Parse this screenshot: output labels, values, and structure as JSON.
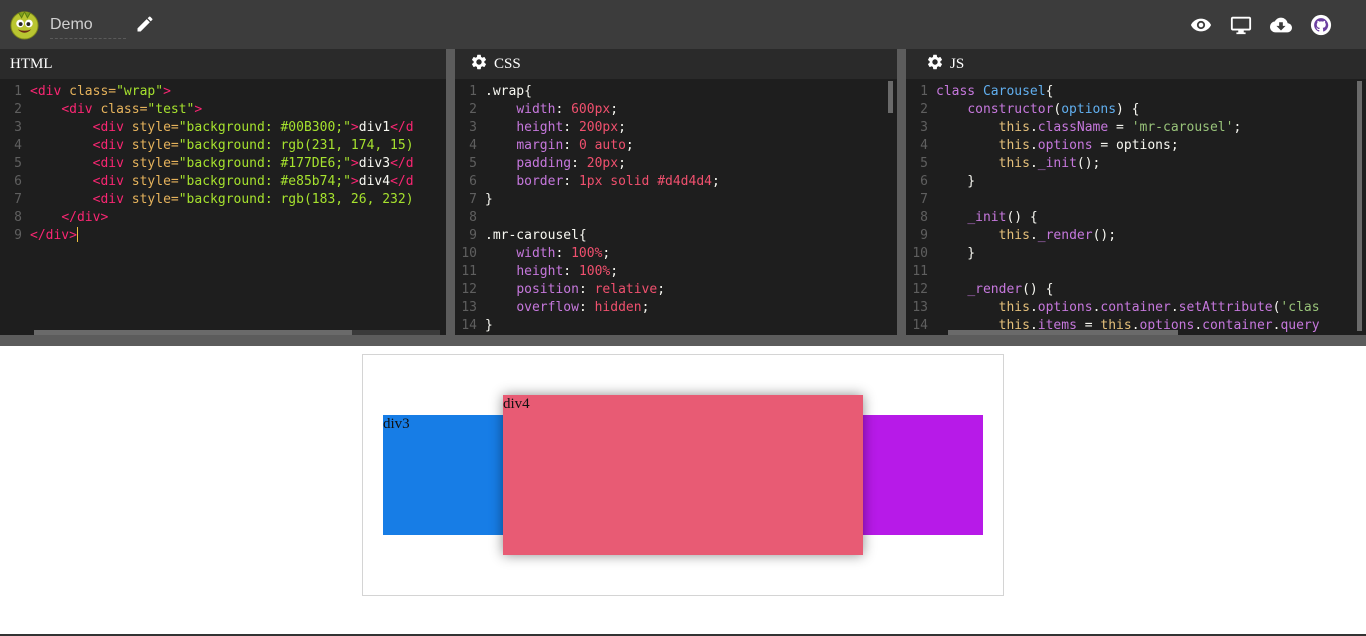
{
  "app": {
    "title": "Demo"
  },
  "icons": {
    "logo": "avatar-logo",
    "edit": "pencil-icon",
    "preview": "eye-icon",
    "display": "monitor-icon",
    "download": "cloud-download-icon",
    "github": "github-icon",
    "settings": "gear-icon"
  },
  "panels": {
    "html": {
      "label": "HTML"
    },
    "css": {
      "label": "CSS"
    },
    "js": {
      "label": "JS"
    }
  },
  "html_lines": [
    {
      "n": "1",
      "parts": [
        [
          "c-tag",
          "<div "
        ],
        [
          "c-attr",
          "class="
        ],
        [
          "c-str",
          "\"wrap\""
        ],
        [
          "c-tag",
          ">"
        ]
      ]
    },
    {
      "n": "2",
      "parts": [
        [
          "c-plain",
          "    "
        ],
        [
          "c-tag",
          "<div "
        ],
        [
          "c-attr",
          "class="
        ],
        [
          "c-str",
          "\"test\""
        ],
        [
          "c-tag",
          ">"
        ]
      ]
    },
    {
      "n": "3",
      "parts": [
        [
          "c-plain",
          "        "
        ],
        [
          "c-tag",
          "<div "
        ],
        [
          "c-attr",
          "style="
        ],
        [
          "c-str",
          "\"background: #00B300;\""
        ],
        [
          "c-tag",
          ">"
        ],
        [
          "c-plain",
          "div1"
        ],
        [
          "c-tag",
          "</d"
        ]
      ]
    },
    {
      "n": "4",
      "parts": [
        [
          "c-plain",
          "        "
        ],
        [
          "c-tag",
          "<div "
        ],
        [
          "c-attr",
          "style="
        ],
        [
          "c-str",
          "\"background: rgb(231, 174, 15)"
        ]
      ]
    },
    {
      "n": "5",
      "parts": [
        [
          "c-plain",
          "        "
        ],
        [
          "c-tag",
          "<div "
        ],
        [
          "c-attr",
          "style="
        ],
        [
          "c-str",
          "\"background: #177DE6;\""
        ],
        [
          "c-tag",
          ">"
        ],
        [
          "c-plain",
          "div3"
        ],
        [
          "c-tag",
          "</d"
        ]
      ]
    },
    {
      "n": "6",
      "parts": [
        [
          "c-plain",
          "        "
        ],
        [
          "c-tag",
          "<div "
        ],
        [
          "c-attr",
          "style="
        ],
        [
          "c-str",
          "\"background: #e85b74;\""
        ],
        [
          "c-tag",
          ">"
        ],
        [
          "c-plain",
          "div4"
        ],
        [
          "c-tag",
          "</d"
        ]
      ]
    },
    {
      "n": "7",
      "parts": [
        [
          "c-plain",
          "        "
        ],
        [
          "c-tag",
          "<div "
        ],
        [
          "c-attr",
          "style="
        ],
        [
          "c-str",
          "\"background: rgb(183, 26, 232)"
        ]
      ]
    },
    {
      "n": "8",
      "parts": [
        [
          "c-plain",
          "    "
        ],
        [
          "c-tag",
          "</div>"
        ]
      ]
    },
    {
      "n": "9",
      "parts": [
        [
          "c-tag",
          "</div>"
        ]
      ]
    }
  ],
  "css_lines": [
    {
      "n": "1",
      "parts": [
        [
          "c-sel",
          ".wrap{"
        ]
      ]
    },
    {
      "n": "2",
      "parts": [
        [
          "c-plain",
          "    "
        ],
        [
          "c-prop",
          "width"
        ],
        [
          "c-plain",
          ": "
        ],
        [
          "c-val",
          "600px"
        ],
        [
          "c-plain",
          ";"
        ]
      ]
    },
    {
      "n": "3",
      "parts": [
        [
          "c-plain",
          "    "
        ],
        [
          "c-prop",
          "height"
        ],
        [
          "c-plain",
          ": "
        ],
        [
          "c-val",
          "200px"
        ],
        [
          "c-plain",
          ";"
        ]
      ]
    },
    {
      "n": "4",
      "parts": [
        [
          "c-plain",
          "    "
        ],
        [
          "c-prop",
          "margin"
        ],
        [
          "c-plain",
          ": "
        ],
        [
          "c-val",
          "0 auto"
        ],
        [
          "c-plain",
          ";"
        ]
      ]
    },
    {
      "n": "5",
      "parts": [
        [
          "c-plain",
          "    "
        ],
        [
          "c-prop",
          "padding"
        ],
        [
          "c-plain",
          ": "
        ],
        [
          "c-val",
          "20px"
        ],
        [
          "c-plain",
          ";"
        ]
      ]
    },
    {
      "n": "6",
      "parts": [
        [
          "c-plain",
          "    "
        ],
        [
          "c-prop",
          "border"
        ],
        [
          "c-plain",
          ": "
        ],
        [
          "c-val",
          "1px solid #d4d4d4"
        ],
        [
          "c-plain",
          ";"
        ]
      ]
    },
    {
      "n": "7",
      "parts": [
        [
          "c-sel",
          "}"
        ]
      ]
    },
    {
      "n": "8",
      "parts": []
    },
    {
      "n": "9",
      "parts": [
        [
          "c-sel",
          ".mr-carousel{"
        ]
      ]
    },
    {
      "n": "10",
      "parts": [
        [
          "c-plain",
          "    "
        ],
        [
          "c-prop",
          "width"
        ],
        [
          "c-plain",
          ": "
        ],
        [
          "c-val",
          "100%"
        ],
        [
          "c-plain",
          ";"
        ]
      ]
    },
    {
      "n": "11",
      "parts": [
        [
          "c-plain",
          "    "
        ],
        [
          "c-prop",
          "height"
        ],
        [
          "c-plain",
          ": "
        ],
        [
          "c-val",
          "100%"
        ],
        [
          "c-plain",
          ";"
        ]
      ]
    },
    {
      "n": "12",
      "parts": [
        [
          "c-plain",
          "    "
        ],
        [
          "c-prop",
          "position"
        ],
        [
          "c-plain",
          ": "
        ],
        [
          "c-val",
          "relative"
        ],
        [
          "c-plain",
          ";"
        ]
      ]
    },
    {
      "n": "13",
      "parts": [
        [
          "c-plain",
          "    "
        ],
        [
          "c-prop",
          "overflow"
        ],
        [
          "c-plain",
          ": "
        ],
        [
          "c-val",
          "hidden"
        ],
        [
          "c-plain",
          ";"
        ]
      ]
    },
    {
      "n": "14",
      "parts": [
        [
          "c-sel",
          "}"
        ]
      ]
    }
  ],
  "js_lines": [
    {
      "n": "1",
      "parts": [
        [
          "c-kw",
          "class "
        ],
        [
          "c-cls",
          "Carousel"
        ],
        [
          "c-plain",
          "{"
        ]
      ]
    },
    {
      "n": "2",
      "parts": [
        [
          "c-plain",
          "    "
        ],
        [
          "c-kw",
          "constructor"
        ],
        [
          "c-plain",
          "("
        ],
        [
          "c-cls",
          "options"
        ],
        [
          "c-plain",
          ") {"
        ]
      ]
    },
    {
      "n": "3",
      "parts": [
        [
          "c-plain",
          "        "
        ],
        [
          "c-this",
          "this"
        ],
        [
          "c-plain",
          "."
        ],
        [
          "c-prop",
          "className"
        ],
        [
          "c-plain",
          " = "
        ],
        [
          "c-jstr",
          "'mr-carousel'"
        ],
        [
          "c-plain",
          ";"
        ]
      ]
    },
    {
      "n": "4",
      "parts": [
        [
          "c-plain",
          "        "
        ],
        [
          "c-this",
          "this"
        ],
        [
          "c-plain",
          "."
        ],
        [
          "c-prop",
          "options"
        ],
        [
          "c-plain",
          " = options;"
        ]
      ]
    },
    {
      "n": "5",
      "parts": [
        [
          "c-plain",
          "        "
        ],
        [
          "c-this",
          "this"
        ],
        [
          "c-plain",
          "."
        ],
        [
          "c-prop",
          "_init"
        ],
        [
          "c-plain",
          "();"
        ]
      ]
    },
    {
      "n": "6",
      "parts": [
        [
          "c-plain",
          "    }"
        ]
      ]
    },
    {
      "n": "7",
      "parts": []
    },
    {
      "n": "8",
      "parts": [
        [
          "c-plain",
          "    "
        ],
        [
          "c-prop",
          "_init"
        ],
        [
          "c-plain",
          "() {"
        ]
      ]
    },
    {
      "n": "9",
      "parts": [
        [
          "c-plain",
          "        "
        ],
        [
          "c-this",
          "this"
        ],
        [
          "c-plain",
          "."
        ],
        [
          "c-prop",
          "_render"
        ],
        [
          "c-plain",
          "();"
        ]
      ]
    },
    {
      "n": "10",
      "parts": [
        [
          "c-plain",
          "    }"
        ]
      ]
    },
    {
      "n": "11",
      "parts": []
    },
    {
      "n": "12",
      "parts": [
        [
          "c-plain",
          "    "
        ],
        [
          "c-prop",
          "_render"
        ],
        [
          "c-plain",
          "() {"
        ]
      ]
    },
    {
      "n": "13",
      "parts": [
        [
          "c-plain",
          "        "
        ],
        [
          "c-this",
          "this"
        ],
        [
          "c-plain",
          "."
        ],
        [
          "c-prop",
          "options"
        ],
        [
          "c-plain",
          "."
        ],
        [
          "c-prop",
          "container"
        ],
        [
          "c-plain",
          "."
        ],
        [
          "c-prop",
          "setAttribute"
        ],
        [
          "c-plain",
          "("
        ],
        [
          "c-jstr",
          "'clas"
        ]
      ]
    },
    {
      "n": "14",
      "parts": [
        [
          "c-plain",
          "        "
        ],
        [
          "c-this",
          "this"
        ],
        [
          "c-plain",
          "."
        ],
        [
          "c-prop",
          "items"
        ],
        [
          "c-plain",
          " = "
        ],
        [
          "c-this",
          "this"
        ],
        [
          "c-plain",
          "."
        ],
        [
          "c-prop",
          "options"
        ],
        [
          "c-plain",
          "."
        ],
        [
          "c-prop",
          "container"
        ],
        [
          "c-plain",
          "."
        ],
        [
          "c-prop",
          "query"
        ]
      ]
    }
  ],
  "preview": {
    "slides": [
      {
        "label": "div3",
        "color": "#177DE6"
      },
      {
        "label": "",
        "color": "#B71AE8"
      },
      {
        "label": "div4",
        "color": "#e85b74"
      }
    ]
  }
}
